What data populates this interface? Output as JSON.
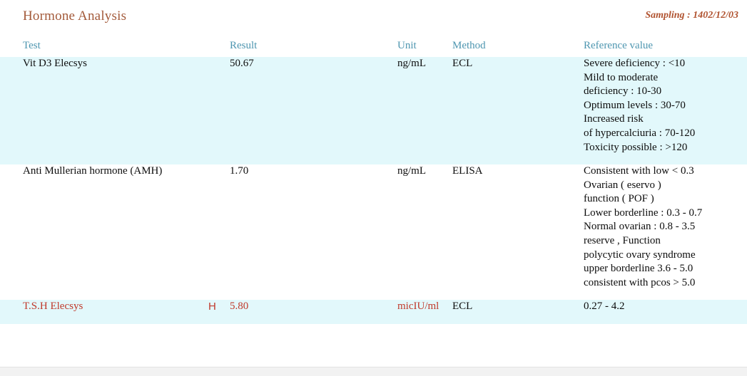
{
  "report": {
    "title": "Hormone Analysis",
    "sampling_label": "Sampling : 1402/12/03",
    "title_color": "#a35a3a",
    "sampling_color": "#b0522f",
    "header_color": "#4e96b0",
    "stripe_color": "#e2f8fb",
    "abnormal_color": "#c0392b"
  },
  "table": {
    "columns": {
      "test": "Test",
      "result": "Result",
      "unit": "Unit",
      "method": "Method",
      "reference": "Reference value"
    },
    "rows": [
      {
        "test": "Vit D3 Elecsys",
        "flag": "",
        "result": "50.67",
        "unit": "ng/mL",
        "method": "ECL",
        "reference": "Severe deficiency : <10\nMild to moderate\n deficiency : 10-30\nOptimum levels : 30-70\nIncreased risk\nof hypercalciuria : 70-120\nToxicity possible : >120",
        "striped": true,
        "abnormal": false
      },
      {
        "test": "Anti Mullerian hormone (AMH)",
        "flag": "",
        "result": "1.70",
        "unit": "ng/mL",
        "method": "ELISA",
        "reference": "Consistent with low < 0.3\nOvarian ( eservo )\nfunction ( POF )\nLower borderline : 0.3 - 0.7\nNormal ovarian : 0.8 - 3.5\nreserve , Function\npolycytic ovary syndrome\nupper borderline 3.6 - 5.0\nconsistent with pcos > 5.0",
        "striped": false,
        "abnormal": false
      },
      {
        "test": "T.S.H Elecsys",
        "flag": "H",
        "result": "5.80",
        "unit": "micIU/ml",
        "method": "ECL",
        "reference": "0.27 - 4.2",
        "striped": true,
        "abnormal": true
      }
    ]
  }
}
